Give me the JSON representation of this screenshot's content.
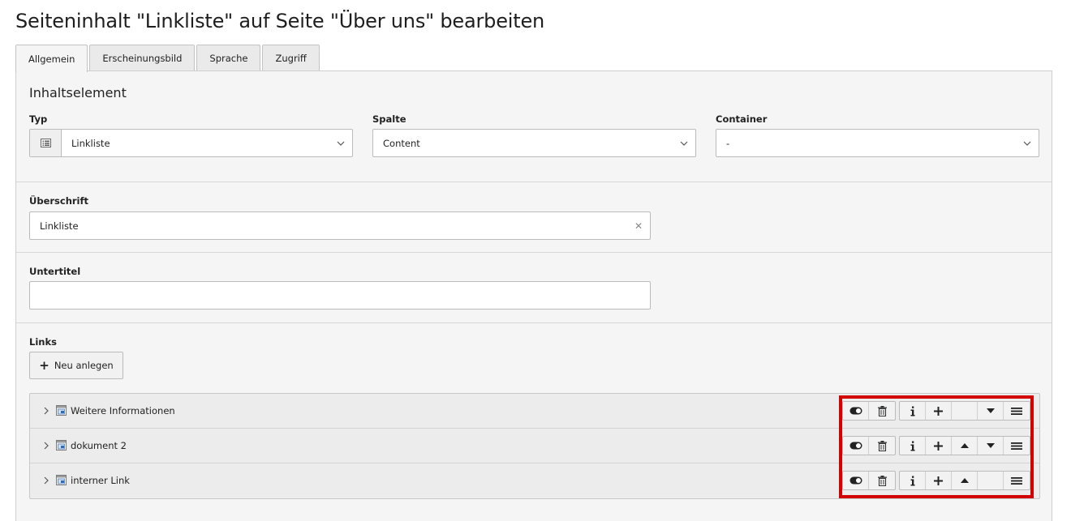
{
  "page": {
    "title": "Seiteninhalt \"Linkliste\" auf Seite \"Über uns\" bearbeiten"
  },
  "tabs": [
    {
      "label": "Allgemein",
      "active": true
    },
    {
      "label": "Erscheinungsbild",
      "active": false
    },
    {
      "label": "Sprache",
      "active": false
    },
    {
      "label": "Zugriff",
      "active": false
    }
  ],
  "content_element": {
    "heading": "Inhaltselement",
    "typ": {
      "label": "Typ",
      "value": "Linkliste",
      "icon": "list-icon"
    },
    "spalte": {
      "label": "Spalte",
      "value": "Content"
    },
    "container": {
      "label": "Container",
      "value": "-"
    }
  },
  "header_field": {
    "label": "Überschrift",
    "value": "Linkliste"
  },
  "subheader_field": {
    "label": "Untertitel",
    "value": ""
  },
  "links": {
    "label": "Links",
    "new_button": "Neu anlegen",
    "items": [
      {
        "title": "Weitere Informationen",
        "move_up": false,
        "move_down": true
      },
      {
        "title": "dokument 2",
        "move_up": true,
        "move_down": true
      },
      {
        "title": "interner Link",
        "move_up": true,
        "move_down": false
      }
    ],
    "controls": [
      "toggle-visibility-icon",
      "trash-icon",
      "info-icon",
      "plus-icon",
      "arrow-up-icon",
      "arrow-down-icon",
      "drag-handle-icon"
    ]
  },
  "colors": {
    "highlight": "#d30000",
    "panel_bg": "#f5f5f5",
    "record_bg": "#ececec"
  }
}
